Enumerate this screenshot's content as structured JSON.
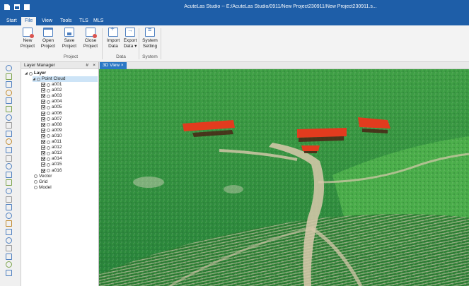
{
  "titlebar": {
    "title": "AcuteLas Studio -- E:/AcuteLas Studio/0911/New Project230911/New Project230911.s..."
  },
  "menu_tabs": [
    "Start",
    "File",
    "View",
    "Tools",
    "TLS",
    "MLS"
  ],
  "active_tab": "File",
  "ribbon": {
    "buttons": [
      {
        "line1": "New",
        "line2": "Project",
        "icon": "new-project-icon"
      },
      {
        "line1": "Open",
        "line2": "Project",
        "icon": "open-project-icon"
      },
      {
        "line1": "Save",
        "line2": "Project",
        "icon": "save-project-icon"
      },
      {
        "line1": "Close",
        "line2": "Project",
        "icon": "close-project-icon"
      },
      {
        "line1": "Import",
        "line2": "Data",
        "icon": "import-data-icon"
      },
      {
        "line1": "Export",
        "line2": "Data ▾",
        "icon": "export-data-icon"
      },
      {
        "line1": "System",
        "line2": "Setting",
        "icon": "settings-icon"
      }
    ],
    "groups": [
      "Project",
      "Data",
      "System"
    ]
  },
  "layer_manager": {
    "title": "Layer Manager",
    "pin": "#",
    "close": "×",
    "root": "Layer",
    "point_cloud": "Point Cloud",
    "items": [
      "a001",
      "a002",
      "a003",
      "a004",
      "a005",
      "a006",
      "a007",
      "a008",
      "a009",
      "a010",
      "a011",
      "a012",
      "a013",
      "a014",
      "a015",
      "a016"
    ],
    "other_layers": [
      "Vector",
      "Grid",
      "Model"
    ]
  },
  "view_tab": {
    "label": "3D View ×"
  },
  "colors": {
    "titlebar": "#1e5ea8",
    "vegetation": "#2f8f3a",
    "highlight": "#e23b1e",
    "path": "#d9c9ad"
  }
}
